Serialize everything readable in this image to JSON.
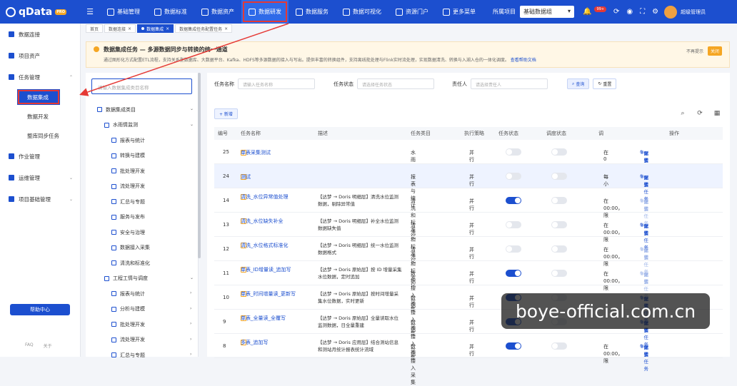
{
  "app": {
    "logo_text": "qData",
    "pro": "PRO"
  },
  "nav": [
    {
      "label": "基础管理",
      "icon": "base-icon"
    },
    {
      "label": "数据标准",
      "icon": "standard-icon"
    },
    {
      "label": "数据资产",
      "icon": "asset-icon"
    },
    {
      "label": "数据研发",
      "icon": "dev-icon",
      "active": true
    },
    {
      "label": "数据服务",
      "icon": "service-icon"
    },
    {
      "label": "数据可视化",
      "icon": "visual-icon"
    },
    {
      "label": "资源门户",
      "icon": "portal-icon"
    },
    {
      "label": "更多菜单",
      "icon": "more-icon"
    }
  ],
  "project": {
    "label": "所属项目",
    "value": "基础数据组"
  },
  "notify_count": "99+",
  "user": {
    "name": "超级管理员"
  },
  "sidebar": {
    "groups": [
      {
        "label": "数据连接"
      },
      {
        "label": "项目资产"
      },
      {
        "label": "任务管理"
      },
      {
        "label": "作业管理"
      },
      {
        "label": "运维管理"
      },
      {
        "label": "项目基础管理"
      }
    ],
    "subs": [
      {
        "label": "数据集成",
        "active": true
      },
      {
        "label": "数据开发"
      },
      {
        "label": "整库同步任务"
      }
    ],
    "help": "帮助中心",
    "footer": [
      "FAQ",
      "关于"
    ]
  },
  "tabs": [
    "首页",
    "数据连接",
    "数据集成",
    "数据集成任务配置任务"
  ],
  "notice": {
    "title": "数据集成任务 — 多源数据同步与转换的统一通道",
    "desc": "通过图形化方式配置ETL流程，支持关系型数据库、大数据平台、Kafka、HDFS等多源数据的接入与写出。提供丰富的转换组件，支持离线批处理与Flink实时流处理，实现数据清洗、转换与入湖入仓的一体化调度。",
    "link": "查看帮助文档",
    "hide": "不再提示",
    "close": "关闭"
  },
  "tree": {
    "search_placeholder": "请输入数据集成类目名称",
    "nodes": [
      {
        "label": "数据集成类目",
        "level": 0
      },
      {
        "label": "水雨情监测",
        "level": 1
      },
      {
        "label": "报表与统计",
        "level": 2
      },
      {
        "label": "转换与建模",
        "level": 2
      },
      {
        "label": "批处理开发",
        "level": 2
      },
      {
        "label": "流处理开发",
        "level": 2
      },
      {
        "label": "汇总与专题",
        "level": 2
      },
      {
        "label": "服务与发布",
        "level": 2
      },
      {
        "label": "安全与治理",
        "level": 2
      },
      {
        "label": "数据接入采集",
        "level": 2
      },
      {
        "label": "清洗和标准化",
        "level": 2
      },
      {
        "label": "工程工情与调度",
        "level": 1
      },
      {
        "label": "报表与统计",
        "level": 2
      },
      {
        "label": "分析与建模",
        "level": 2
      },
      {
        "label": "批处理开发",
        "level": 2
      },
      {
        "label": "流处理开发",
        "level": 2
      },
      {
        "label": "汇总与专题",
        "level": 2
      }
    ]
  },
  "filter": {
    "name_label": "任务名称",
    "name_ph": "请输入任务名称",
    "status_label": "任务状态",
    "status_ph": "请选择任务状态",
    "owner_label": "责任人",
    "owner_ph": "请选择责任人",
    "query": "查询",
    "reset": "重置"
  },
  "add_btn": "+ 新增",
  "columns": [
    "编号",
    "任务名称",
    "描述",
    "任务类目",
    "执行策略",
    "任务状态",
    "调度状态",
    "调",
    "操作"
  ],
  "rows": [
    {
      "id": "25",
      "name": "单表采集测试",
      "desc": "",
      "cat": "水雨情监测",
      "strategy": "并行",
      "task_on": false,
      "sched_on": false,
      "sched": "在0",
      "ops_dim": false
    },
    {
      "id": "24",
      "name": "测试",
      "desc": "",
      "cat": "报表与统计",
      "strategy": "并行",
      "task_on": false,
      "sched_on": false,
      "sched": "每小",
      "ops_dim": false
    },
    {
      "id": "14",
      "name": "清洗_水位异常值处理",
      "desc": "【达梦 → Doris 明细层】清洗水位监测数据，剔除异常值",
      "cat": "清洗和标准化",
      "strategy": "并行",
      "task_on": true,
      "sched_on": false,
      "sched": "在00:00，限",
      "ops_dim": true
    },
    {
      "id": "13",
      "name": "清洗_水位缺失补全",
      "desc": "【达梦 → Doris 明细层】补全水位监测数据缺失值",
      "cat": "清洗和标准化",
      "strategy": "并行",
      "task_on": false,
      "sched_on": false,
      "sched": "在00:00，限",
      "ops_dim": false
    },
    {
      "id": "12",
      "name": "清洗_水位格式标准化",
      "desc": "【达梦 → Doris 明细层】统一水位监测数据格式",
      "cat": "清洗和标准化",
      "strategy": "并行",
      "task_on": false,
      "sched_on": false,
      "sched": "在00:00，限",
      "ops_dim": true
    },
    {
      "id": "11",
      "name": "单表_ID增量读_追加写",
      "desc": "【达梦 → Doris 原始层】按 ID 增量采集水位数据，定时追加",
      "cat": "数据接入采集",
      "strategy": "并行",
      "task_on": true,
      "sched_on": false,
      "sched": "在00:00，限",
      "ops_dim": true
    },
    {
      "id": "10",
      "name": "单表_时间增量读_更新写",
      "desc": "【达梦 → Doris 原始层】按时间增量采集水位数据，实时更新",
      "cat": "数据接入采集",
      "strategy": "并行",
      "task_on": true,
      "sched_on": false,
      "sched": "",
      "ops_dim": false
    },
    {
      "id": "9",
      "name": "单表_全量读_全覆写",
      "desc": "【达梦 → Doris 原始层】全量读取水位监测数据，日全量重建",
      "cat": "数据接入采集",
      "strategy": "并行",
      "task_on": true,
      "sched_on": false,
      "sched": "",
      "ops_dim": false
    },
    {
      "id": "8",
      "name": "多表_追加写",
      "desc": "【达梦 → Doris 应用层】结合测站信息和测站月统计报表统计流域",
      "cat": "数据接入采集",
      "strategy": "并行",
      "task_on": true,
      "sched_on": false,
      "sched": "在00:00，限",
      "ops_dim": false
    }
  ],
  "ops": [
    "配置任务",
    "详情",
    "更多"
  ],
  "watermark": "boye-official.com.cn",
  "colors": {
    "primary": "#1c4fcf",
    "highlight": "#e53935",
    "warn": "#f5a623"
  }
}
